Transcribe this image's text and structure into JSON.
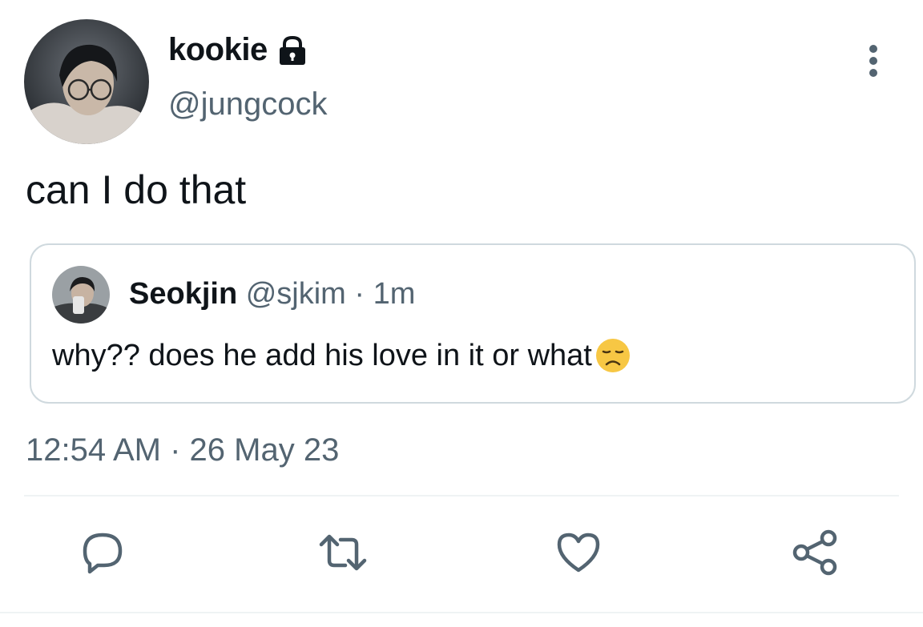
{
  "author": {
    "display_name": "kookie",
    "handle": "@jungcock",
    "protected": true
  },
  "tweet": {
    "text": "can I do that",
    "timestamp": "12:54 AM · 26 May 23"
  },
  "quoted": {
    "display_name": "Seokjin",
    "handle": "@sjkim",
    "separator": "·",
    "age": "1m",
    "text": "why?? does he add his love in it or what",
    "emoji": "disappointed-face"
  },
  "icons": {
    "lock": "lock-icon",
    "more": "more-vertical-icon",
    "reply": "reply-icon",
    "retweet": "retweet-icon",
    "like": "heart-icon",
    "share": "share-icon"
  },
  "colors": {
    "text": "#0f1419",
    "secondary": "#536471",
    "border": "#cfd9de",
    "divider": "#eff3f4"
  }
}
